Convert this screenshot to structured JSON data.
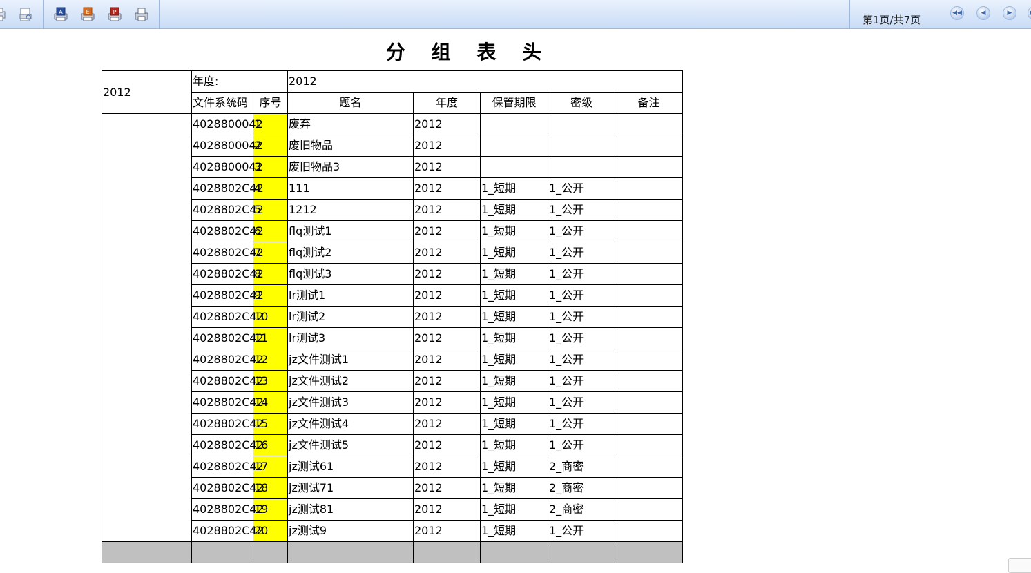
{
  "toolbar": {
    "page_info": "第1页/共7页",
    "left_icons": [
      "print-setup-icon",
      "print-preview-icon"
    ],
    "export_icons": [
      "export-a-icon",
      "export-e-icon",
      "export-p-icon",
      "printer-icon"
    ],
    "nav_icons": [
      "first-page-icon",
      "prev-page-icon",
      "next-page-icon",
      "last-page-icon"
    ]
  },
  "report": {
    "title": "分 组 表 头",
    "group_label": "2012",
    "year_label": "年度:",
    "year_value": "2012",
    "headers": [
      "文件系统码",
      "序号",
      "题名",
      "年度",
      "保管期限",
      "密级",
      "备注"
    ],
    "rows": [
      {
        "code": "4028800042",
        "seq": "1",
        "title": "废弃",
        "year": "2012",
        "period": "",
        "level": "",
        "note": ""
      },
      {
        "code": "4028800042",
        "seq": "2",
        "title": "废旧物品",
        "year": "2012",
        "period": "",
        "level": "",
        "note": ""
      },
      {
        "code": "4028800042",
        "seq": "3",
        "title": "废旧物品3",
        "year": "2012",
        "period": "",
        "level": "",
        "note": ""
      },
      {
        "code": "4028802C42",
        "seq": "4",
        "title": "111",
        "year": "2012",
        "period": "1_短期",
        "level": "1_公开",
        "note": ""
      },
      {
        "code": "4028802C42",
        "seq": "5",
        "title": "1212",
        "year": "2012",
        "period": "1_短期",
        "level": "1_公开",
        "note": ""
      },
      {
        "code": "4028802C42",
        "seq": "6",
        "title": "flq测试1",
        "year": "2012",
        "period": "1_短期",
        "level": "1_公开",
        "note": ""
      },
      {
        "code": "4028802C42",
        "seq": "7",
        "title": "flq测试2",
        "year": "2012",
        "period": "1_短期",
        "level": "1_公开",
        "note": ""
      },
      {
        "code": "4028802C42",
        "seq": "8",
        "title": "flq测试3",
        "year": "2012",
        "period": "1_短期",
        "level": "1_公开",
        "note": ""
      },
      {
        "code": "4028802C42",
        "seq": "9",
        "title": "lr测试1",
        "year": "2012",
        "period": "1_短期",
        "level": "1_公开",
        "note": ""
      },
      {
        "code": "4028802C42",
        "seq": "10",
        "title": "lr测试2",
        "year": "2012",
        "period": "1_短期",
        "level": "1_公开",
        "note": ""
      },
      {
        "code": "4028802C42",
        "seq": "11",
        "title": "lr测试3",
        "year": "2012",
        "period": "1_短期",
        "level": "1_公开",
        "note": ""
      },
      {
        "code": "4028802C42",
        "seq": "12",
        "title": "jz文件测试1",
        "year": "2012",
        "period": "1_短期",
        "level": "1_公开",
        "note": ""
      },
      {
        "code": "4028802C42",
        "seq": "13",
        "title": "jz文件测试2",
        "year": "2012",
        "period": "1_短期",
        "level": "1_公开",
        "note": ""
      },
      {
        "code": "4028802C42",
        "seq": "14",
        "title": "jz文件测试3",
        "year": "2012",
        "period": "1_短期",
        "level": "1_公开",
        "note": ""
      },
      {
        "code": "4028802C42",
        "seq": "15",
        "title": "jz文件测试4",
        "year": "2012",
        "period": "1_短期",
        "level": "1_公开",
        "note": ""
      },
      {
        "code": "4028802C42",
        "seq": "16",
        "title": "jz文件测试5",
        "year": "2012",
        "period": "1_短期",
        "level": "1_公开",
        "note": ""
      },
      {
        "code": "4028802C42",
        "seq": "17",
        "title": "jz测试61",
        "year": "2012",
        "period": "1_短期",
        "level": "2_商密",
        "note": ""
      },
      {
        "code": "4028802C42",
        "seq": "18",
        "title": "jz测试71",
        "year": "2012",
        "period": "1_短期",
        "level": "2_商密",
        "note": ""
      },
      {
        "code": "4028802C42",
        "seq": "19",
        "title": "jz测试81",
        "year": "2012",
        "period": "1_短期",
        "level": "2_商密",
        "note": ""
      },
      {
        "code": "4028802C42",
        "seq": "20",
        "title": "jz测试9",
        "year": "2012",
        "period": "1_短期",
        "level": "1_公开",
        "note": ""
      }
    ]
  },
  "colors": {
    "seq_highlight": "#ffff00",
    "footer_gray": "#c0c0c0",
    "toolbar_top": "#e9f1fd",
    "toolbar_bottom": "#c9dcf6"
  }
}
